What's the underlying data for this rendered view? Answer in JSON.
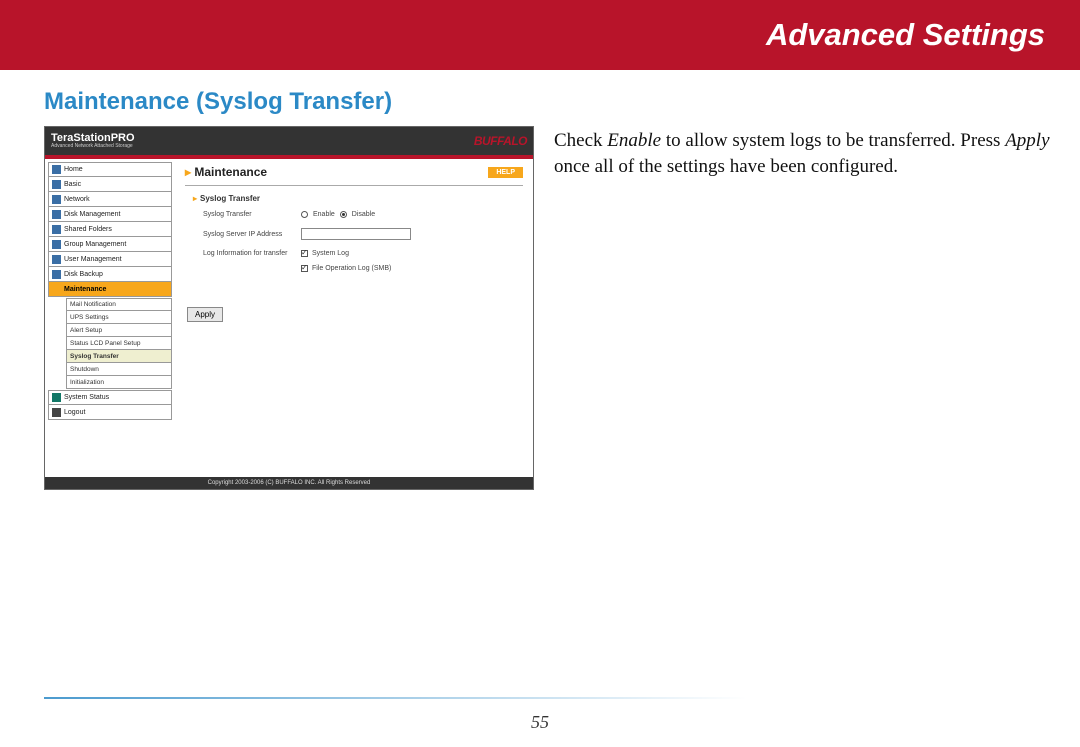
{
  "header": {
    "title": "Advanced Settings"
  },
  "section": {
    "title": "Maintenance (Syslog Transfer)"
  },
  "description": {
    "pre1": "Check ",
    "em1": "Enable",
    "mid1": " to allow system logs to be transferred.  Press ",
    "em2": "Apply",
    "post1": " once all of the settings have been configured."
  },
  "app": {
    "brand": "TeraStationPRO",
    "brand_sub": "Advanced Network Attached Storage",
    "brand_right": "BUFFALO",
    "panel_title": "Maintenance",
    "help": "HELP",
    "sub_heading": "Syslog Transfer",
    "form": {
      "row1_label": "Syslog Transfer",
      "row1_opt1": "Enable",
      "row1_opt2": "Disable",
      "row2_label": "Syslog Server IP Address",
      "row3_label": "Log Information for transfer",
      "row3_chk1": "System Log",
      "row3_chk2": "File Operation Log (SMB)"
    },
    "apply": "Apply",
    "footer": "Copyright 2003-2006 (C) BUFFALO INC. All Rights Reserved"
  },
  "nav": {
    "items": [
      "Home",
      "Basic",
      "Network",
      "Disk Management",
      "Shared Folders",
      "Group Management",
      "User Management",
      "Disk Backup",
      "Maintenance"
    ],
    "subs": [
      "Mail Notification",
      "UPS Settings",
      "Alert Setup",
      "Status LCD Panel Setup",
      "Syslog Transfer",
      "Shutdown",
      "Initialization"
    ],
    "tail": [
      "System Status",
      "Logout"
    ]
  },
  "page_number": "55"
}
